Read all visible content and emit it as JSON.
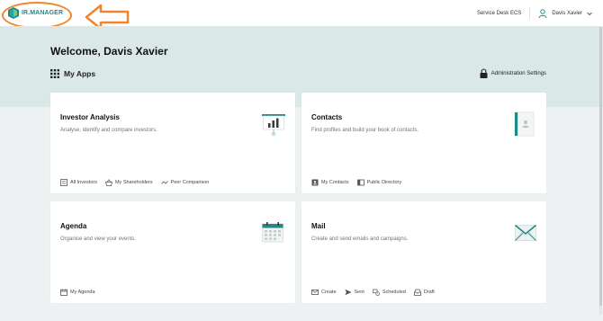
{
  "header": {
    "logo_text": "IR.MANAGER",
    "service_desk": "Service Desk ECS",
    "user_name": "Davis Xavier"
  },
  "hero": {
    "welcome": "Welcome, Davis Xavier",
    "my_apps": "My Apps",
    "admin_settings": "Administration Settings"
  },
  "cards": {
    "investor": {
      "title": "Investor Analysis",
      "desc": "Analyse, identify and compare investors.",
      "links": [
        "All Investors",
        "My Shareholders",
        "Peer Comparison"
      ]
    },
    "contacts": {
      "title": "Contacts",
      "desc": "Find profiles and build your book of contacts.",
      "links": [
        "My Contacts",
        "Public Directory"
      ]
    },
    "agenda": {
      "title": "Agenda",
      "desc": "Organise and view your events.",
      "links": [
        "My Agenda"
      ]
    },
    "mail": {
      "title": "Mail",
      "desc": "Create and send emails and campaigns.",
      "links": [
        "Create",
        "Sent",
        "Scheduled",
        "Draft"
      ]
    }
  },
  "colors": {
    "brand": "#1f8a88",
    "annotation": "#f0852d",
    "hero_bg": "#dbe8e8",
    "page_bg": "#eef1f2"
  }
}
